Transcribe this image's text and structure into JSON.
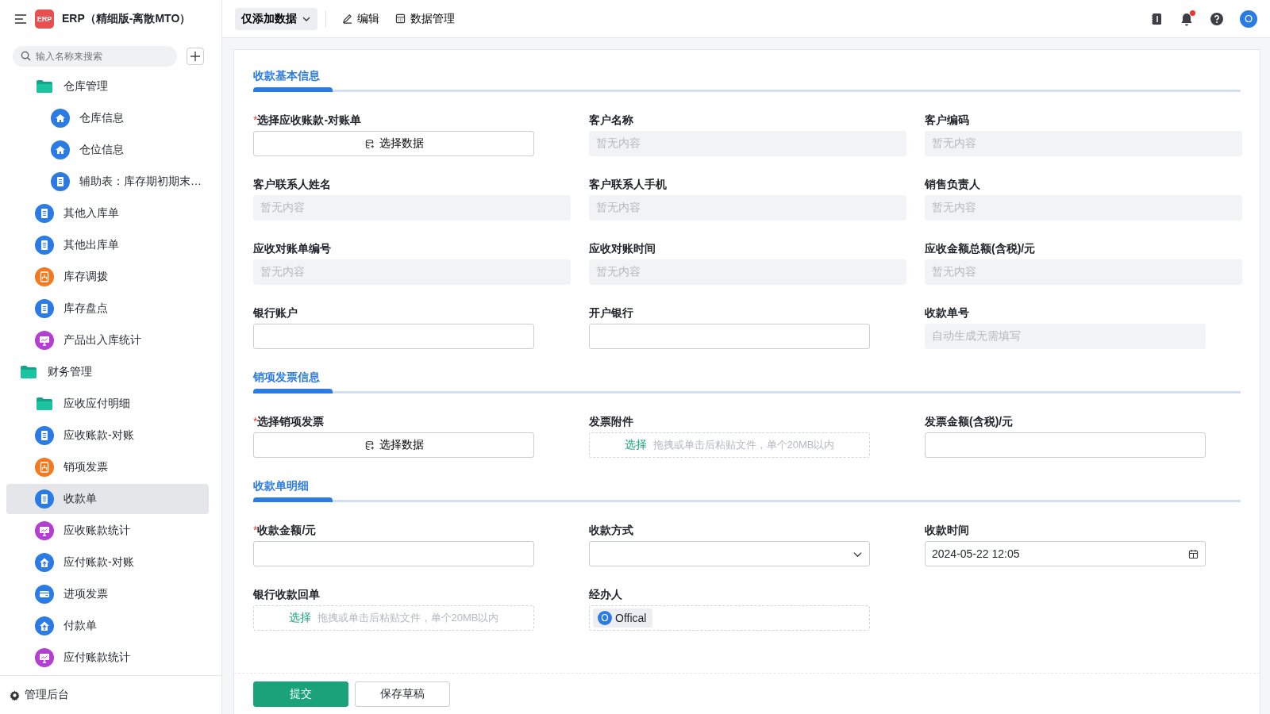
{
  "app": {
    "logo_text": "ERP",
    "title": "ERP（精细版-离散MTO）"
  },
  "sidebar": {
    "search": {
      "placeholder": "输入名称来搜索"
    },
    "tree": [
      {
        "children": [
          {
            "label": "仓库管理",
            "kind": "folder",
            "selected": false,
            "children": [
              {
                "label": "仓库信息",
                "kind": "home",
                "selected": false
              },
              {
                "label": "仓位信息",
                "kind": "home",
                "selected": false
              },
              {
                "label": "辅助表：库存期初期末…",
                "kind": "doc",
                "selected": false
              }
            ]
          },
          {
            "label": "其他入库单",
            "kind": "doc",
            "selected": false
          },
          {
            "label": "其他出库单",
            "kind": "doc",
            "selected": false
          },
          {
            "label": "库存调拨",
            "kind": "org",
            "selected": false
          },
          {
            "label": "库存盘点",
            "kind": "doc",
            "selected": false
          },
          {
            "label": "产品出入库统计",
            "kind": "monitor",
            "selected": false
          }
        ]
      },
      {
        "label": "财务管理",
        "kind": "folder",
        "selected": false,
        "children": [
          {
            "label": "应收应付明细",
            "kind": "folder",
            "selected": false
          },
          {
            "label": "应收账款-对账",
            "kind": "doc",
            "selected": false
          },
          {
            "label": "销项发票",
            "kind": "org",
            "selected": false
          },
          {
            "label": "收款单",
            "kind": "doc",
            "selected": true
          },
          {
            "label": "应收账款统计",
            "kind": "monitor",
            "selected": false
          },
          {
            "label": "应付账款-对账",
            "kind": "upload",
            "selected": false
          },
          {
            "label": "进项发票",
            "kind": "card",
            "selected": false
          },
          {
            "label": "付款单",
            "kind": "upload",
            "selected": false
          },
          {
            "label": "应付账款统计",
            "kind": "monitor",
            "selected": false
          }
        ]
      }
    ],
    "footer": "管理后台"
  },
  "toolbar": {
    "view_menu": "仅添加数据",
    "edit": "编辑",
    "data_manage": "数据管理",
    "notification_dot": true,
    "avatar": "O"
  },
  "form": {
    "sections": [
      {
        "title": "收款基本信息",
        "fields": [
          {
            "label": "选择应收账款-对账单",
            "required_mark": "*",
            "kind": "picker",
            "button_text": "选择数据"
          },
          {
            "label": "客户名称",
            "kind": "display",
            "placeholder": "暂无内容"
          },
          {
            "label": "客户编码",
            "kind": "display",
            "placeholder": "暂无内容"
          },
          {
            "label": "客户联系人姓名",
            "kind": "display",
            "placeholder": "暂无内容"
          },
          {
            "label": "客户联系人手机",
            "kind": "display",
            "placeholder": "暂无内容"
          },
          {
            "label": "销售负责人",
            "kind": "display",
            "placeholder": "暂无内容"
          },
          {
            "label": "应收对账单编号",
            "kind": "display",
            "placeholder": "暂无内容"
          },
          {
            "label": "应收对账时间",
            "kind": "display",
            "placeholder": "暂无内容"
          },
          {
            "label": "应收金额总额(含税)/元",
            "kind": "display",
            "placeholder": "暂无内容"
          },
          {
            "label": "银行账户",
            "kind": "input"
          },
          {
            "label": "开户银行",
            "kind": "input"
          },
          {
            "label": "收款单号",
            "kind": "auto",
            "placeholder": "自动生成无需填写"
          }
        ]
      },
      {
        "title": "销项发票信息",
        "fields": [
          {
            "label": "选择销项发票",
            "required_mark": "*",
            "kind": "picker",
            "button_text": "选择数据"
          },
          {
            "label": "发票附件",
            "kind": "upload",
            "action_text": "选择",
            "hint": "拖拽或单击后粘贴文件，单个20MB以内"
          },
          {
            "label": "发票金额(含税)/元",
            "kind": "input"
          }
        ]
      },
      {
        "title": "收款单明细",
        "fields": [
          {
            "label": "收款金额/元",
            "required_mark": "*",
            "kind": "input"
          },
          {
            "label": "收款方式",
            "kind": "select"
          },
          {
            "label": "收款时间",
            "kind": "datetime",
            "value": "2024-05-22 12:05"
          },
          {
            "label": "银行收款回单",
            "kind": "upload",
            "action_text": "选择",
            "hint": "拖拽或单击后粘贴文件，单个20MB以内"
          },
          {
            "label": "经办人",
            "kind": "member",
            "member": {
              "initial": "O",
              "name": "Offical"
            }
          }
        ]
      }
    ],
    "buttons": [
      {
        "label": "提交",
        "kind": "primary"
      },
      {
        "label": "保存草稿",
        "kind": "secondary"
      }
    ]
  }
}
